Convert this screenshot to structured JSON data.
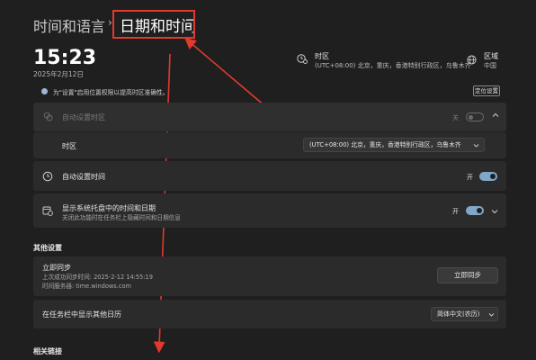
{
  "breadcrumb": {
    "parent": "时间和语言",
    "separator": "›",
    "current": "日期和时间"
  },
  "clock": {
    "time": "15:23",
    "date": "2025年2月12日"
  },
  "summary": {
    "timezone_title": "时区",
    "timezone_value": "(UTC+08:00) 北京，重庆，香港特别行政区，乌鲁木齐",
    "region_title": "区域",
    "region_value": "中国"
  },
  "info": {
    "text": "为\"设置\"启用位置权限以提高时区准确性。",
    "location_button": "定位设置"
  },
  "auto_timezone": {
    "label": "自动设置时区",
    "state_label": "关",
    "toggle_on": false
  },
  "timezone_row": {
    "label": "时区",
    "value": "(UTC+08:00) 北京，重庆，香港特别行政区，乌鲁木齐"
  },
  "auto_time": {
    "label": "自动设置时间",
    "state_label": "开",
    "toggle_on": true
  },
  "tray": {
    "label": "显示系统托盘中的时间和日期",
    "sublabel": "关闭此功能时在任务栏上隐藏时间和日期信息",
    "state_label": "开",
    "toggle_on": true
  },
  "other_settings": {
    "title": "其他设置",
    "sync": {
      "title": "立即同步",
      "last_sync": "上次成功同步时间: 2025-2-12 14:55:19",
      "server": "时间服务器: time.windows.com",
      "button": "立即同步"
    },
    "calendar": {
      "label": "在任务栏中显示其他日历",
      "value": "简体中文(农历)"
    }
  },
  "related": {
    "title": "相关链接"
  },
  "annotation_color": "#e03a2f",
  "accent_color": "#7fa7c9",
  "icons": [
    "timezone-icon",
    "globe-icon",
    "sync-icon",
    "clock-icon",
    "calendar-clock-icon",
    "info-icon",
    "chevron-up-icon",
    "chevron-down-icon"
  ]
}
